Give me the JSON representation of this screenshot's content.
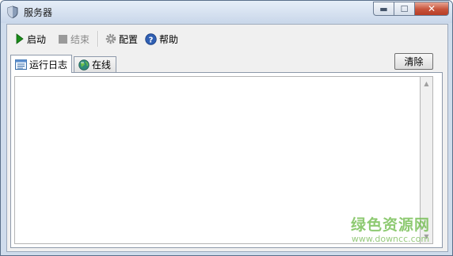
{
  "window": {
    "title": "服务器",
    "controls": {
      "minimize": "▬",
      "maximize": "☐",
      "close": "✕"
    }
  },
  "toolbar": {
    "start_label": "启动",
    "stop_label": "结束",
    "config_label": "配置",
    "help_label": "帮助"
  },
  "tabs": [
    {
      "label": "运行日志",
      "icon": "log-list-icon",
      "active": true
    },
    {
      "label": "在线",
      "icon": "globe-icon",
      "active": false
    }
  ],
  "clear_button_label": "清除",
  "log": {
    "content": ""
  },
  "scrollbar": {
    "up": "▲",
    "down": "▼"
  },
  "watermark": {
    "title": "绿色资源网",
    "url": "www.downcc.com"
  },
  "colors": {
    "start_green": "#1a8c1a",
    "help_blue": "#2f5fb3",
    "watermark_green": "#69b944"
  }
}
